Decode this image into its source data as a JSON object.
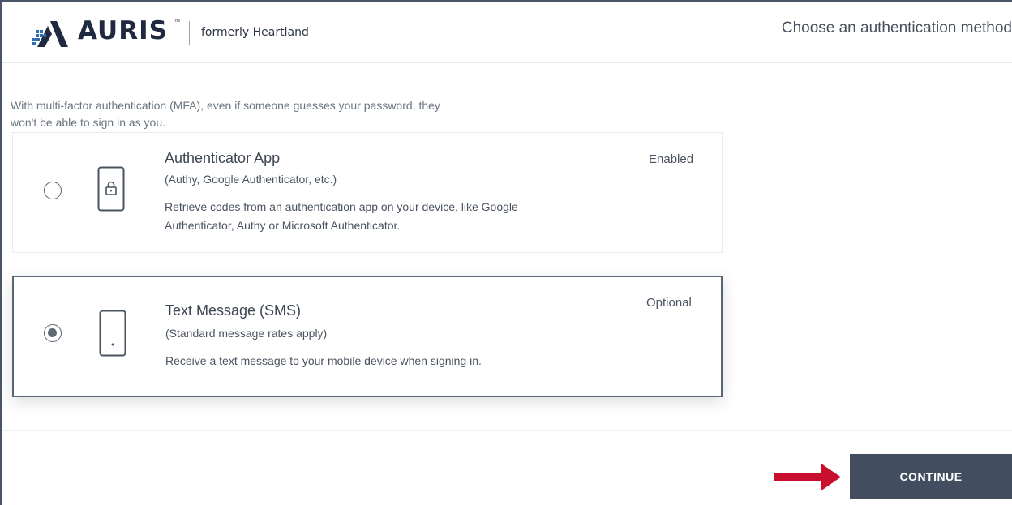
{
  "brand": {
    "name": "AURIS",
    "trademark": "™",
    "formerly": "formerly Heartland",
    "colors": {
      "navy": "#1f2a40",
      "accent_blue": "#2f6fb5"
    }
  },
  "header": {
    "title": "Choose an authentication method"
  },
  "intro": {
    "text": "With multi-factor authentication (MFA), even if someone guesses your password, they won't be able to sign in as you."
  },
  "methods": [
    {
      "title": "Authenticator App",
      "subtitle": "(Authy, Google Authenticator, etc.)",
      "description": "Retrieve codes from an authentication app on your device, like Google Authenticator, Authy or Microsoft Authenticator.",
      "status": "Enabled",
      "selected": false,
      "icon": "phone-lock-icon"
    },
    {
      "title": "Text Message (SMS)",
      "subtitle": "(Standard message rates apply)",
      "description": "Receive a text message to your mobile device when signing in.",
      "status": "Optional",
      "selected": true,
      "icon": "mobile-phone-icon"
    }
  ],
  "footer": {
    "continue_label": "CONTINUE",
    "arrow_color": "#c8102e",
    "button_color": "#424d60"
  }
}
